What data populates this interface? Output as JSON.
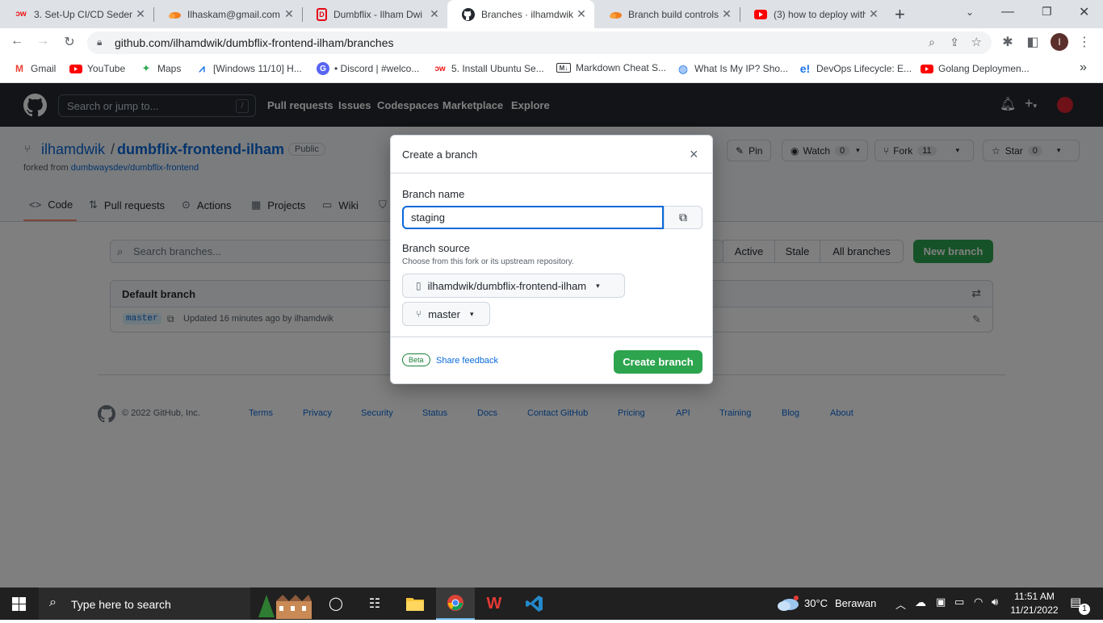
{
  "browser": {
    "tabs": [
      {
        "title": "3. Set-Up CI/CD Seder",
        "favicon": "dumbways"
      },
      {
        "title": "Ilhaskam@gmail.com",
        "favicon": "cloudflare"
      },
      {
        "title": "Dumbflix - Ilham Dwi",
        "favicon": "dumbflix"
      },
      {
        "title": "Branches · ilhamdwik/",
        "favicon": "github"
      },
      {
        "title": "Branch build controls",
        "favicon": "cloudflare"
      },
      {
        "title": "(3) how to deploy with",
        "favicon": "youtube"
      }
    ],
    "active_tab": 3,
    "new_tab": "+",
    "url": "github.com/ilhamdwik/dumbflix-frontend-ilham/branches",
    "profile_initial": "I",
    "bookmarks": [
      {
        "label": "Gmail",
        "icon": "gmail-icon"
      },
      {
        "label": "YouTube",
        "icon": "youtube-icon"
      },
      {
        "label": "Maps",
        "icon": "maps-icon"
      },
      {
        "label": "[Windows 11/10] H...",
        "icon": "link-icon"
      },
      {
        "label": "• Discord | #welco...",
        "icon": "discord-icon"
      },
      {
        "label": "5. Install Ubuntu Se...",
        "icon": "dumbways-icon"
      },
      {
        "label": "Markdown Cheat S...",
        "icon": "markdown-icon"
      },
      {
        "label": "What Is My IP? Sho...",
        "icon": "globe-icon"
      },
      {
        "label": "DevOps Lifecycle: E...",
        "icon": "edureka-icon"
      },
      {
        "label": "Golang Deploymen...",
        "icon": "youtube-icon"
      }
    ],
    "bookmarks_more": "»"
  },
  "github": {
    "search_placeholder": "Search or jump to...",
    "search_shortcut": "/",
    "nav": [
      "Pull requests",
      "Issues",
      "Codespaces",
      "Marketplace",
      "Explore"
    ]
  },
  "repo": {
    "owner": "ilhamdwik",
    "separator": "/",
    "name": "dumbflix-frontend-ilham",
    "visibility": "Public",
    "forked_from_label": "forked from",
    "forked_from": "dumbwaysdev/dumbflix-frontend",
    "pin": "Pin",
    "watch": "Watch",
    "watch_count": "0",
    "fork": "Fork",
    "fork_count": "11",
    "star": "Star",
    "star_count": "0",
    "tabs": [
      "Code",
      "Pull requests",
      "Actions",
      "Projects",
      "Wiki"
    ]
  },
  "branches": {
    "search_placeholder": "Search branches...",
    "filters": [
      "Active",
      "Stale",
      "All branches"
    ],
    "new_branch": "New branch",
    "default_branch_title": "Default branch",
    "default_branch_name": "master",
    "default_branch_updated": "Updated 16 minutes ago by ilhamdwik"
  },
  "footer": {
    "copyright": "© 2022 GitHub, Inc.",
    "links": [
      "Terms",
      "Privacy",
      "Security",
      "Status",
      "Docs",
      "Contact GitHub",
      "Pricing",
      "API",
      "Training",
      "Blog",
      "About"
    ]
  },
  "dialog": {
    "title": "Create a branch",
    "close": "×",
    "branch_name_label": "Branch name",
    "branch_name_value": "staging",
    "branch_source_label": "Branch source",
    "branch_source_hint": "Choose from this fork or its upstream repository.",
    "repo_select": "ilhamdwik/dumbflix-frontend-ilham",
    "branch_select": "master",
    "beta": "Beta",
    "share_feedback": "Share feedback",
    "create_button": "Create branch"
  },
  "taskbar": {
    "search_placeholder": "Type here to search",
    "weather_temp": "30°C",
    "weather_desc": "Berawan",
    "time": "11:51 AM",
    "date": "11/21/2022",
    "notification_count": "1"
  },
  "colors": {
    "github_dark": "#24292f",
    "primary_green": "#2da44e",
    "link_blue": "#0969da",
    "focus_blue": "#0969da"
  }
}
